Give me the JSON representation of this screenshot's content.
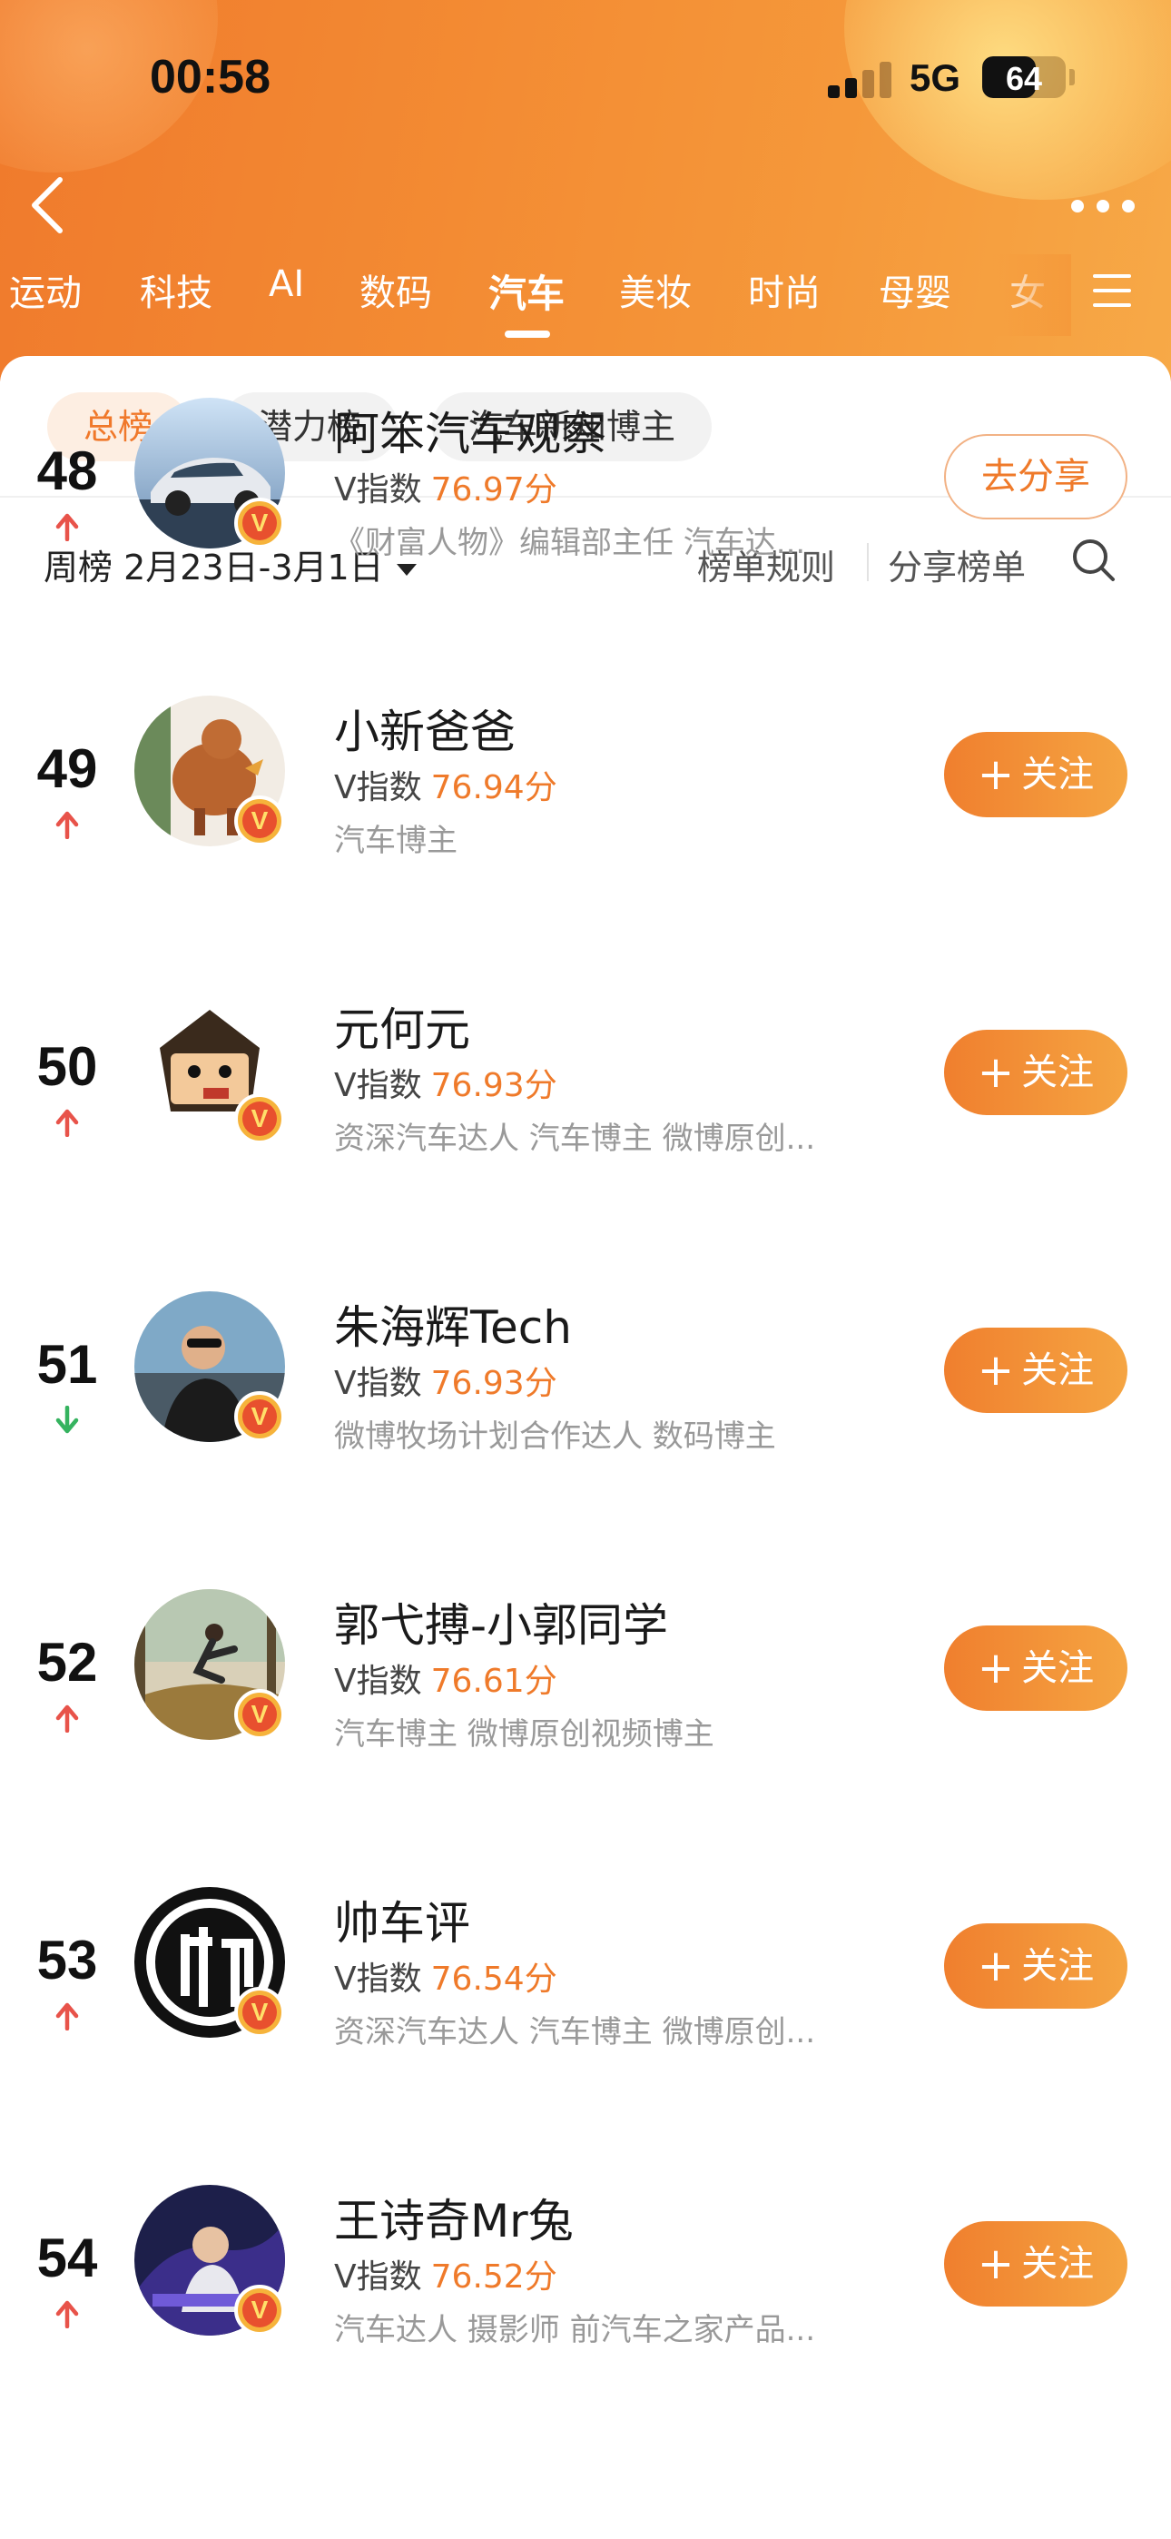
{
  "status_bar": {
    "time": "00:58",
    "network": "5G",
    "battery": "64",
    "battery_level": 0.64
  },
  "tabs": [
    "运动",
    "科技",
    "AI",
    "数码",
    "汽车",
    "美妆",
    "时尚",
    "母婴",
    "女"
  ],
  "active_tab": "汽车",
  "chips": [
    "总榜",
    "潜力榜",
    "汽车新知博主"
  ],
  "filter": {
    "week_label": "周榜 2月23日-3月1日",
    "rules_label": "榜单规则",
    "share_label": "分享榜单"
  },
  "follow_label": "关注",
  "share_btn_label": "去分享",
  "vindex_label": "V指数",
  "colors": {
    "accent": "#ef7a2a",
    "up": "#e8534a",
    "down": "#35b35f"
  },
  "rows": [
    {
      "rank": "48",
      "trend": "up",
      "name": "阿笨汽车观察",
      "score": "76.97分",
      "desc": "《财富人物》编辑部主任 汽车达...",
      "action": "share"
    },
    {
      "rank": "49",
      "trend": "up",
      "name": "小新爸爸",
      "score": "76.94分",
      "desc": "汽车博主",
      "action": "follow"
    },
    {
      "rank": "50",
      "trend": "up",
      "name": "元何元",
      "score": "76.93分",
      "desc": "资深汽车达人 汽车博主 微博原创...",
      "action": "follow"
    },
    {
      "rank": "51",
      "trend": "down",
      "name": "朱海辉Tech",
      "score": "76.93分",
      "desc": "微博牧场计划合作达人 数码博主",
      "action": "follow"
    },
    {
      "rank": "52",
      "trend": "up",
      "name": "郭弋搏-小郭同学",
      "score": "76.61分",
      "desc": "汽车博主 微博原创视频博主",
      "action": "follow"
    },
    {
      "rank": "53",
      "trend": "up",
      "name": "帅车评",
      "score": "76.54分",
      "desc": "资深汽车达人 汽车博主 微博原创...",
      "action": "follow"
    },
    {
      "rank": "54",
      "trend": "up",
      "name": "王诗奇Mr兔",
      "score": "76.52分",
      "desc": "汽车达人 摄影师 前汽车之家产品...",
      "action": "follow"
    }
  ]
}
